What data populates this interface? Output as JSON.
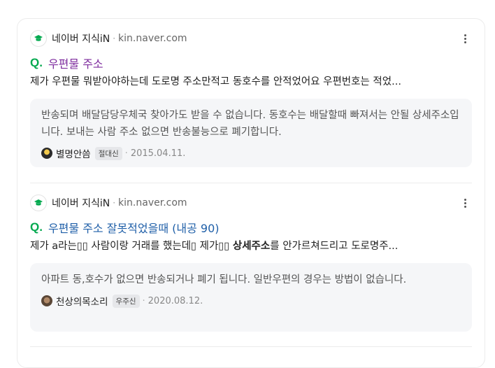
{
  "results": [
    {
      "source_name": "네이버 지식iN",
      "source_url": "kin.naver.com",
      "title": "우편물 주소",
      "snippet": "제가 우편물 뭐받아야하는데 도로명 주소만적고 동호수를 안적었어요 우편번호는 적었...",
      "answer": "반송되며 배달담당우체국 찾아가도 받을 수 없습니다. 동호수는 배달할때 빠져서는 안될 상세주소입니다. 보내는 사람 주소 없으면 반송불능으로 폐기합니다.",
      "user": "별명안씀",
      "badge": "절대신",
      "date": "2015.04.11."
    },
    {
      "source_name": "네이버 지식iN",
      "source_url": "kin.naver.com",
      "title": "우편물 주소 잘못적었을때 (내공 90)",
      "snippet_pre": "제가 a라는▯▯ 사람이랑 거래를 했는데▯ 제가▯▯ ",
      "snippet_bold": "상세주소",
      "snippet_post": "를 안가르쳐드리고 도로명주...",
      "answer": "아파트 동,호수가 없으면 반송되거나 폐기 됩니다. 일반우편의 경우는 방법이 없습니다.",
      "user": "천상의목소리",
      "badge": "우주신",
      "date": "2020.08.12."
    }
  ],
  "q_mark": "Q.",
  "separator": "·",
  "colors": {
    "visited_title": "#7e2c9e",
    "title": "#1f5fa8",
    "q_mark": "#03a94f"
  },
  "icons": {
    "favicon": "naver-kin-icon",
    "more": "more-vertical-icon"
  }
}
